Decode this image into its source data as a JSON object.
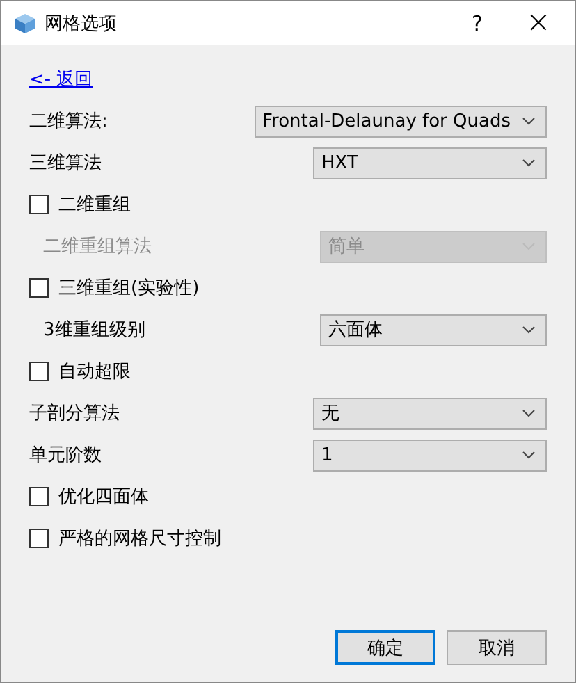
{
  "window": {
    "title": "网格选项",
    "help": "?",
    "close": "×"
  },
  "back_link": "<- 返回",
  "rows": [
    {
      "kind": "select",
      "label": "二维算法:",
      "value": "Frontal-Delaunay for Quads",
      "disabled": false
    },
    {
      "kind": "select",
      "label": "三维算法",
      "value": "HXT",
      "disabled": false
    },
    {
      "kind": "checkbox",
      "label": "二维重组",
      "checked": false,
      "children": [
        {
          "kind": "select",
          "label": "二维重组算法",
          "value": "简单",
          "disabled": true
        }
      ]
    },
    {
      "kind": "checkbox",
      "label": "三维重组(实验性)",
      "checked": false,
      "children": [
        {
          "kind": "select",
          "label": "3维重组级别",
          "value": "六面体",
          "disabled": false
        }
      ]
    },
    {
      "kind": "checkbox",
      "label": "自动超限",
      "checked": false
    },
    {
      "kind": "select",
      "label": "子剖分算法",
      "value": "无",
      "disabled": false
    },
    {
      "kind": "select",
      "label": "单元阶数",
      "value": "1",
      "disabled": false
    },
    {
      "kind": "checkbox",
      "label": "优化四面体",
      "checked": false
    },
    {
      "kind": "checkbox",
      "label": "严格的网格尺寸控制",
      "checked": false
    }
  ],
  "buttons": [
    {
      "label": "确定",
      "selected": true
    },
    {
      "label": "取消",
      "selected": false
    }
  ]
}
